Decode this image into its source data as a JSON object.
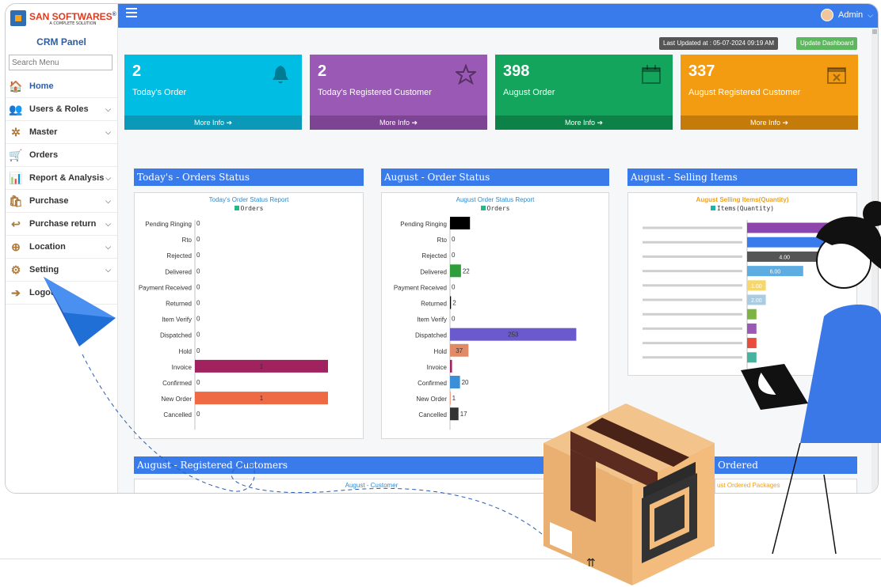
{
  "brand": {
    "name_a": "SAN SOFTWARES",
    "registered": "®",
    "tagline": "A COMPLETE SOLUTION"
  },
  "sidebar": {
    "title": "CRM Panel",
    "search_placeholder": "Search Menu",
    "items": [
      {
        "label": "Home",
        "icon": "home-icon",
        "active": true,
        "chevron": ""
      },
      {
        "label": "Users & Roles",
        "icon": "users-icon",
        "chevron": "⌵"
      },
      {
        "label": "Master",
        "icon": "master-icon",
        "chevron": "⌵"
      },
      {
        "label": "Orders",
        "icon": "cart-icon",
        "chevron": ""
      },
      {
        "label": "Report & Analysis",
        "icon": "report-icon",
        "chevron": "⌵"
      },
      {
        "label": "Purchase",
        "icon": "purchase-icon",
        "chevron": "⌵"
      },
      {
        "label": "Purchase return",
        "icon": "purchase-return-icon",
        "chevron": "⌵"
      },
      {
        "label": "Location",
        "icon": "location-icon",
        "chevron": "⌵"
      },
      {
        "label": "Setting",
        "icon": "gear-icon",
        "chevron": "⌵"
      },
      {
        "label": "Logout",
        "icon": "logout-icon",
        "chevron": ""
      }
    ]
  },
  "topbar": {
    "user": "Admin",
    "user_chevron": "⌵"
  },
  "status": {
    "last_updated": "Last Updated at : 05-07-2024 09:19 AM",
    "update_button": "Update Dashboard"
  },
  "cards": [
    {
      "value": "2",
      "label": "Today's Order",
      "footer": "More Info ➔",
      "color": "#00bde4",
      "foot_color": "#0a99b8",
      "icon": "bell-icon"
    },
    {
      "value": "2",
      "label": "Today's Registered Customer",
      "footer": "More Info ➔",
      "color": "#9b59b6",
      "foot_color": "#7d4494",
      "icon": "star-icon"
    },
    {
      "value": "398",
      "label": "August Order",
      "footer": "More Info ➔",
      "color": "#13a55b",
      "foot_color": "#0d8248",
      "icon": "calendar-icon"
    },
    {
      "value": "337",
      "label": "August Registered Customer",
      "footer": "More Info ➔",
      "color": "#f39c12",
      "foot_color": "#c57b09",
      "icon": "calendar-x-icon"
    }
  ],
  "panels": {
    "today_status": {
      "heading": "Today's - Orders Status"
    },
    "august_status": {
      "heading": "August - Order Status"
    },
    "selling_items": {
      "heading": "August - Selling Items"
    },
    "registered_customers": {
      "heading": "August - Registered Customers",
      "chart_title": "August - Customer"
    },
    "ordered": {
      "heading": "Ordered",
      "chart_title": "ust Ordered Packages"
    }
  },
  "chart_data": [
    {
      "type": "bar",
      "orientation": "horizontal",
      "title": "Today's Order Status Report",
      "legend": [
        "Orders"
      ],
      "categories": [
        "Pending Ringing",
        "Rto",
        "Rejected",
        "Delivered",
        "Payment Received",
        "Returned",
        "Item Verify",
        "Dispatched",
        "Hold",
        "Invoice",
        "Confirmed",
        "New Order",
        "Cancelled"
      ],
      "values": [
        0,
        0,
        0,
        0,
        0,
        0,
        0,
        0,
        0,
        1,
        0,
        1,
        0
      ],
      "colors": [
        "#000000",
        "#000000",
        "#000000",
        "#000000",
        "#000000",
        "#000000",
        "#000000",
        "#000000",
        "#000000",
        "#a0225e",
        "#000000",
        "#ee6a45",
        "#000000"
      ],
      "xlim": [
        0,
        1
      ]
    },
    {
      "type": "bar",
      "orientation": "horizontal",
      "title": "August Order Status Report",
      "legend": [
        "Orders"
      ],
      "categories": [
        "Pending Ringing",
        "Rto",
        "Rejected",
        "Delivered",
        "Payment Received",
        "Returned",
        "Item Verify",
        "Dispatched",
        "Hold",
        "Invoice",
        "Confirmed",
        "New Order",
        "Cancelled"
      ],
      "values": [
        40,
        0,
        0,
        22,
        0,
        2,
        0,
        253,
        37,
        4,
        20,
        1,
        17
      ],
      "value_labels": [
        "",
        "0",
        "0",
        "22",
        "0",
        "2",
        "0",
        "253",
        "37",
        "",
        "20",
        "1",
        "17"
      ],
      "colors": [
        "#000000",
        "#000000",
        "#000000",
        "#2e9e3a",
        "#000000",
        "#000000",
        "#000000",
        "#6a5acd",
        "#e08a68",
        "#a0225e",
        "#3a8fd8",
        "#ee6a45",
        "#333333"
      ],
      "xlim": [
        0,
        300
      ]
    },
    {
      "type": "bar",
      "orientation": "horizontal",
      "title": "August Selling Items(Quantity)",
      "legend": [
        "Items(Quantity)"
      ],
      "values": [
        5,
        5,
        4,
        3,
        1,
        1,
        0.5,
        0.5,
        0.5,
        0.5
      ],
      "value_labels": [
        "",
        "",
        "4.00",
        "6.00",
        "1.00",
        "2.00",
        "",
        "",
        "",
        ""
      ],
      "colors": [
        "#8e44ad",
        "#3a7bec",
        "#555555",
        "#5dade2",
        "#f5d76e",
        "#a9cce3",
        "#7cb342",
        "#9b59b6",
        "#e74c3c",
        "#45b39d"
      ],
      "xlim": [
        0,
        5
      ]
    }
  ]
}
